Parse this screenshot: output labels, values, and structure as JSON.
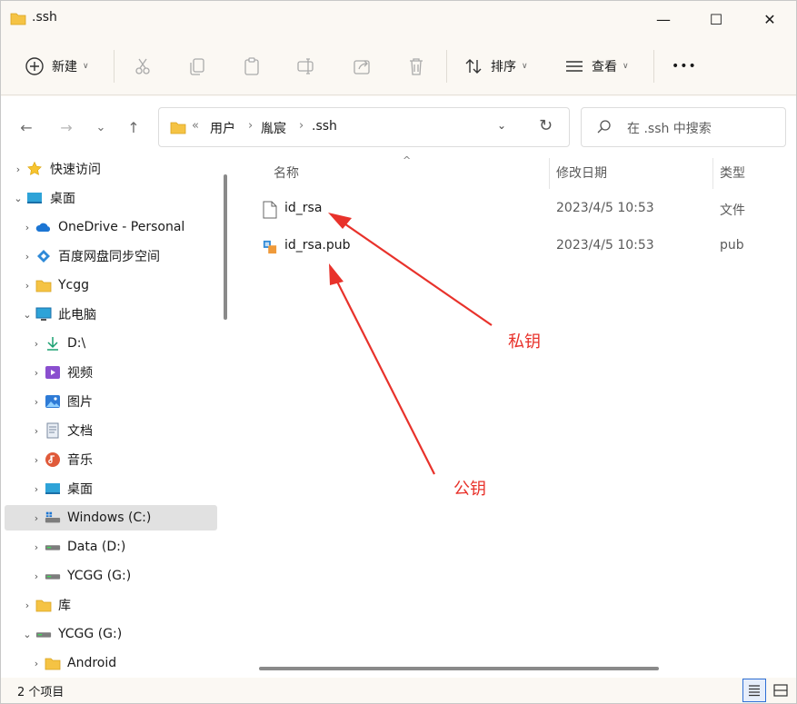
{
  "window": {
    "title": ".ssh",
    "minimize_glyph": "—",
    "maximize_glyph": "☐",
    "close_glyph": "✕"
  },
  "toolbar": {
    "new_label": "新建",
    "sort_label": "排序",
    "view_label": "查看",
    "more_glyph": "•••"
  },
  "nav": {
    "back_glyph": "←",
    "forward_glyph": "→",
    "recent_glyph": "⌄",
    "up_glyph": "↑",
    "breadcrumb": [
      "用户",
      "胤宸",
      ".ssh"
    ],
    "overflow_glyph": "«",
    "crumb_sep": "›",
    "dropdown_glyph": "⌄",
    "refresh_glyph": "↻"
  },
  "search": {
    "placeholder": "在 .ssh 中搜索"
  },
  "sidebar": {
    "items": [
      {
        "label": "快速访问",
        "icon": "star-icon",
        "level": 0,
        "chevron": "›"
      },
      {
        "label": "桌面",
        "icon": "desktop-icon",
        "level": 0,
        "chevron": "⌄"
      },
      {
        "label": "OneDrive - Personal",
        "icon": "onedrive-icon",
        "level": 1,
        "chevron": "›"
      },
      {
        "label": "百度网盘同步空间",
        "icon": "baidu-icon",
        "level": 1,
        "chevron": "›"
      },
      {
        "label": "Ycgg",
        "icon": "folder-icon",
        "level": 1,
        "chevron": "›"
      },
      {
        "label": "此电脑",
        "icon": "pc-icon",
        "level": 1,
        "chevron": "⌄"
      },
      {
        "label": "D:\\",
        "icon": "download-icon",
        "level": 2,
        "chevron": "›"
      },
      {
        "label": "视频",
        "icon": "video-icon",
        "level": 2,
        "chevron": "›"
      },
      {
        "label": "图片",
        "icon": "pictures-icon",
        "level": 2,
        "chevron": "›"
      },
      {
        "label": "文档",
        "icon": "documents-icon",
        "level": 2,
        "chevron": "›"
      },
      {
        "label": "音乐",
        "icon": "music-icon",
        "level": 2,
        "chevron": "›"
      },
      {
        "label": "桌面",
        "icon": "desktop-icon",
        "level": 2,
        "chevron": "›"
      },
      {
        "label": "Windows (C:)",
        "icon": "drive-windows-icon",
        "level": 2,
        "chevron": "›",
        "selected": true
      },
      {
        "label": "Data (D:)",
        "icon": "drive-icon",
        "level": 2,
        "chevron": "›"
      },
      {
        "label": "YCGG (G:)",
        "icon": "drive-icon",
        "level": 2,
        "chevron": "›"
      },
      {
        "label": "库",
        "icon": "folder-icon",
        "level": 1,
        "chevron": "›"
      },
      {
        "label": "YCGG (G:)",
        "icon": "drive-icon",
        "level": 1,
        "chevron": "⌄"
      },
      {
        "label": "Android",
        "icon": "folder-icon",
        "level": 2,
        "chevron": "›"
      }
    ]
  },
  "content": {
    "columns": {
      "name": "名称",
      "date": "修改日期",
      "type": "类型"
    },
    "sort_glyph": "^",
    "files": [
      {
        "name": "id_rsa",
        "date": "2023/4/5 10:53",
        "type": "文件",
        "icon": "file-icon"
      },
      {
        "name": "id_rsa.pub",
        "date": "2023/4/5 10:53",
        "type": "pub",
        "icon": "pub-file-icon"
      }
    ],
    "annotations": {
      "private_key": "私钥",
      "public_key": "公钥"
    }
  },
  "status": {
    "item_count": "2 个项目"
  },
  "colors": {
    "accent": "#2e6fd6",
    "annotation": "#e8322b",
    "folder": "#f5c344"
  }
}
